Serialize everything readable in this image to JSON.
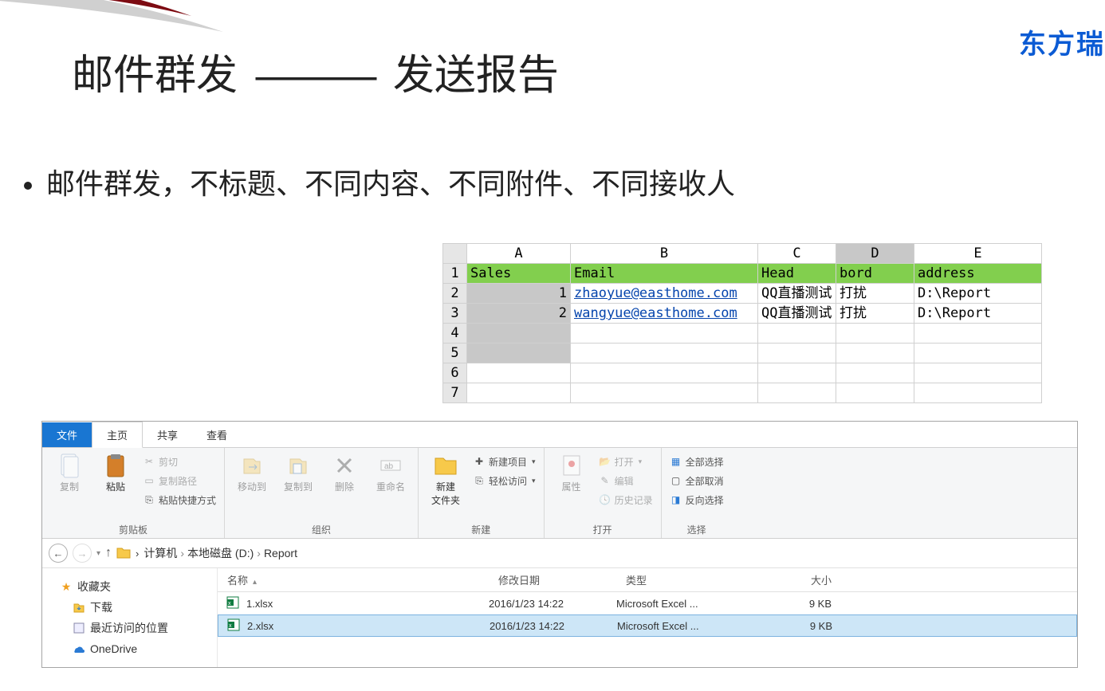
{
  "brand": "东方瑞",
  "title": {
    "left": "邮件群发",
    "dash": "———",
    "right": "发送报告"
  },
  "bullet": "邮件群发，不标题、不同内容、不同附件、不同接收人",
  "excel": {
    "columns": [
      "A",
      "B",
      "C",
      "D",
      "E"
    ],
    "header": [
      "Sales",
      "Email",
      "Head",
      "bord",
      "address"
    ],
    "rows": [
      {
        "n": 1,
        "a": "1",
        "b": "zhaoyue@easthome.com",
        "c": "QQ直播测试",
        "d": "打扰",
        "e": "D:\\Report"
      },
      {
        "n": 2,
        "a": "2",
        "b": "wangyue@easthome.com",
        "c": "QQ直播测试",
        "d": "打扰",
        "e": "D:\\Report"
      }
    ],
    "blankRows": [
      4,
      5,
      6,
      7
    ]
  },
  "explorer": {
    "tabs": {
      "file": "文件",
      "home": "主页",
      "share": "共享",
      "view": "查看"
    },
    "ribbon": {
      "clipboard": {
        "label": "剪贴板",
        "copy": "复制",
        "paste": "粘贴",
        "cut": "剪切",
        "copyPath": "复制路径",
        "pasteShortcut": "粘贴快捷方式"
      },
      "organize": {
        "label": "组织",
        "moveTo": "移动到",
        "copyTo": "复制到",
        "delete": "删除",
        "rename": "重命名"
      },
      "new": {
        "label": "新建",
        "newFolder": "新建\n文件夹",
        "newItem": "新建项目",
        "easyAccess": "轻松访问"
      },
      "open": {
        "label": "打开",
        "properties": "属性",
        "open": "打开",
        "edit": "编辑",
        "history": "历史记录"
      },
      "select": {
        "label": "选择",
        "selectAll": "全部选择",
        "selectNone": "全部取消",
        "invert": "反向选择"
      }
    },
    "breadcrumb": [
      "计算机",
      "本地磁盘 (D:)",
      "Report"
    ],
    "sidebar": {
      "favorites": "收藏夹",
      "downloads": "下载",
      "recent": "最近访问的位置",
      "onedrive": "OneDrive"
    },
    "columns": {
      "name": "名称",
      "date": "修改日期",
      "type": "类型",
      "size": "大小"
    },
    "files": [
      {
        "name": "1.xlsx",
        "date": "2016/1/23 14:22",
        "type": "Microsoft Excel ...",
        "size": "9 KB",
        "selected": false
      },
      {
        "name": "2.xlsx",
        "date": "2016/1/23 14:22",
        "type": "Microsoft Excel ...",
        "size": "9 KB",
        "selected": true
      }
    ]
  }
}
